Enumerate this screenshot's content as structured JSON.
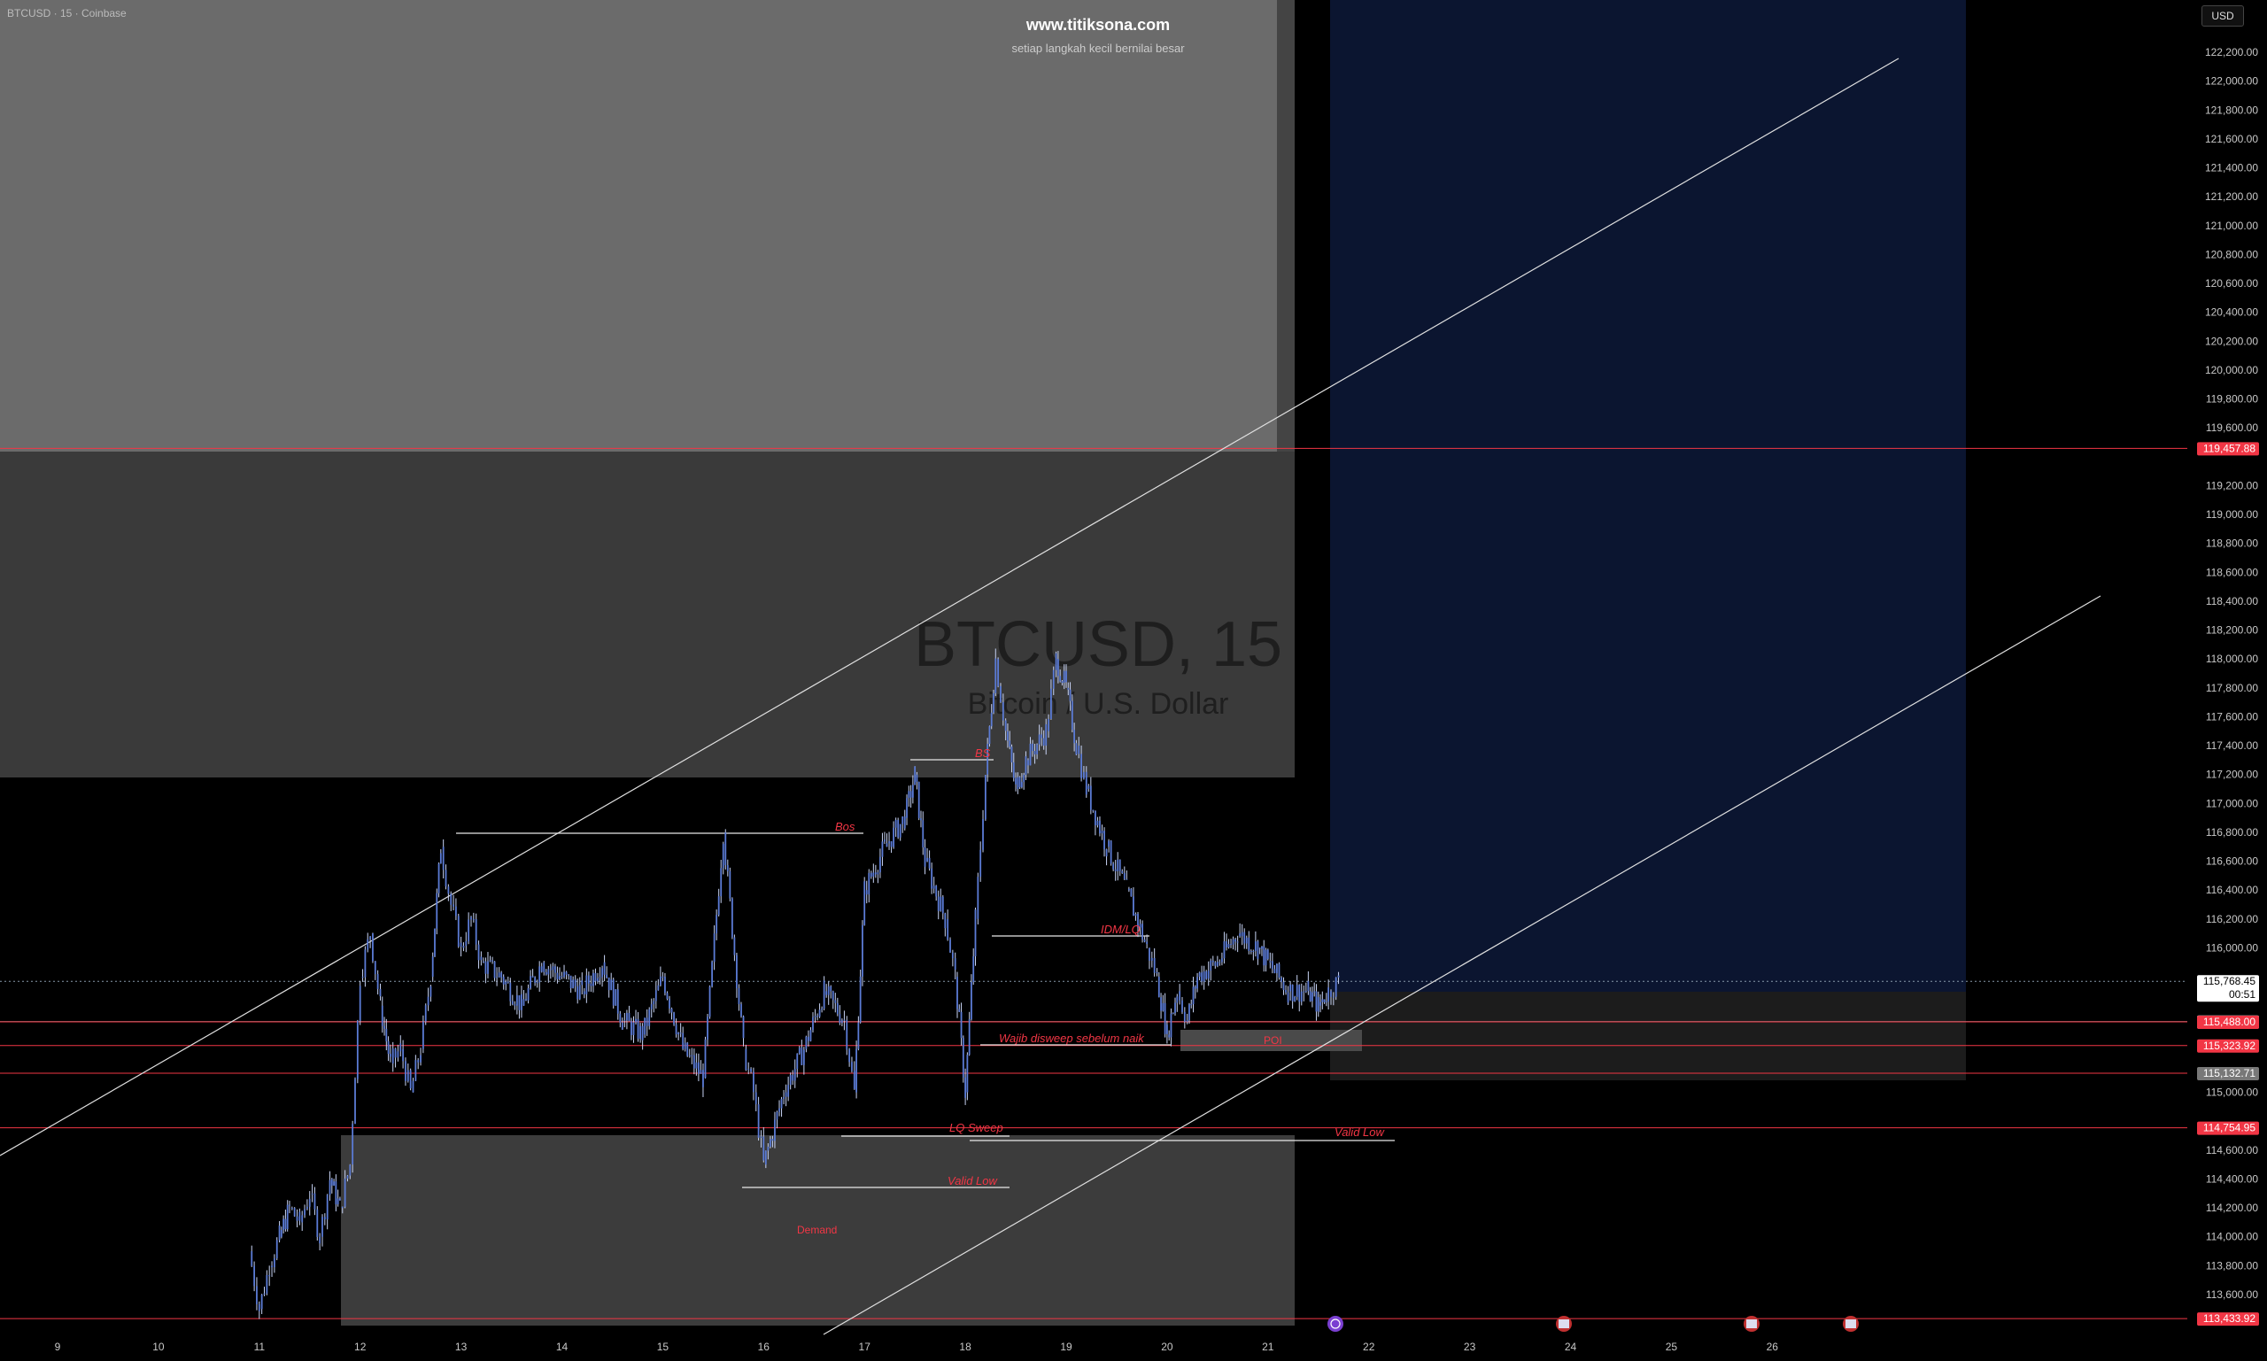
{
  "header": {
    "symbol": "BTCUSD · 15 · Coinbase",
    "brand": "www.titiksona.com",
    "tagline": "setiap langkah kecil bernilai besar",
    "currency_button": "USD"
  },
  "watermark": {
    "symbol": "BTCUSD, 15",
    "description": "Bitcoin / U.S. Dollar"
  },
  "colors": {
    "background": "#000000",
    "candle_up": "#5b7bd5",
    "candle_wick": "#c8d4f5",
    "supply_zone": "#6b6b6b",
    "supply_zone_dark": "#3a3a3a",
    "demand_zone": "#3c3c3c",
    "target_zone": "#0b1530",
    "annotation_red": "#f23645",
    "trendline": "#e0e0e0"
  },
  "annotations": {
    "bos": "Bos",
    "bs": "BS",
    "idm": "IDM/LQ",
    "wajib": "Wajib disweep sebelum naik",
    "poi": "POI",
    "lq_sweep": "LQ Sweep",
    "valid_low_1": "Valid Low",
    "valid_low_2": "Valid Low",
    "demand": "Demand"
  },
  "chart_data": {
    "type": "line",
    "title": "BTCUSD · 15 · Coinbase",
    "xlabel": "",
    "ylabel": "",
    "ylim": [
      113300,
      122300
    ],
    "x_ticks": [
      "9",
      "10",
      "11",
      "12",
      "13",
      "14",
      "15",
      "16",
      "17",
      "18",
      "19",
      "20",
      "21",
      "22",
      "23",
      "24",
      "25",
      "26"
    ],
    "y_ticks": [
      "122,200.00",
      "122,000.00",
      "121,800.00",
      "121,600.00",
      "121,400.00",
      "121,200.00",
      "121,000.00",
      "120,800.00",
      "120,600.00",
      "120,400.00",
      "120,200.00",
      "120,000.00",
      "119,800.00",
      "119,600.00",
      "119,200.00",
      "119,000.00",
      "118,800.00",
      "118,600.00",
      "118,400.00",
      "118,200.00",
      "118,000.00",
      "117,800.00",
      "117,600.00",
      "117,400.00",
      "117,200.00",
      "117,000.00",
      "116,800.00",
      "116,600.00",
      "116,400.00",
      "116,200.00",
      "116,000.00",
      "115,000.00",
      "114,600.00",
      "114,400.00",
      "114,200.00",
      "114,000.00",
      "113,800.00",
      "113,600.00"
    ],
    "series": [
      {
        "x": [
          10.9,
          11.0,
          11.1,
          11.2,
          11.3,
          11.4,
          11.5,
          11.6,
          11.7,
          11.8,
          11.9,
          12.0,
          12.1,
          12.2,
          12.3,
          12.4,
          12.5,
          12.6,
          12.7,
          12.8,
          12.9,
          13.0,
          13.1,
          13.2,
          13.4,
          13.6,
          13.8,
          14.0,
          14.2,
          14.4,
          14.6,
          14.8,
          15.0,
          15.2,
          15.4,
          15.6,
          15.8,
          15.9,
          16.0,
          16.2,
          16.4,
          16.6,
          16.8,
          16.9,
          17.0,
          17.2,
          17.4,
          17.5,
          17.6,
          17.8,
          17.9,
          18.0,
          18.1,
          18.2,
          18.3,
          18.4,
          18.5,
          18.6,
          18.8,
          18.9,
          19.0,
          19.1,
          19.2,
          19.4,
          19.6,
          19.8,
          19.9,
          20.0,
          20.1,
          20.2,
          20.3,
          20.5,
          20.7,
          20.9,
          21.0,
          21.2,
          21.4,
          21.5,
          21.6,
          21.7
        ],
        "values": [
          113900,
          113500,
          113800,
          114000,
          114200,
          114100,
          114300,
          114000,
          114400,
          114200,
          114500,
          115800,
          116100,
          115600,
          115200,
          115300,
          115000,
          115300,
          115800,
          116700,
          116300,
          116000,
          116200,
          115900,
          115800,
          115600,
          115900,
          115800,
          115700,
          115900,
          115500,
          115400,
          115800,
          115300,
          115100,
          116800,
          115300,
          115000,
          114500,
          115000,
          115300,
          115700,
          115500,
          115000,
          116400,
          116700,
          116900,
          117200,
          116600,
          116200,
          115800,
          115000,
          116200,
          117200,
          118000,
          117500,
          117100,
          117300,
          117500,
          118000,
          117800,
          117400,
          117100,
          116700,
          116400,
          116000,
          115800,
          115400,
          115700,
          115500,
          115800,
          115900,
          116100,
          116000,
          115900,
          115700,
          115700,
          115600,
          115700,
          115768
        ]
      }
    ],
    "horizontal_lines": [
      {
        "label": "119,457.88",
        "value": 119457.88
      },
      {
        "label": "115,768.45",
        "value": 115768.45
      },
      {
        "label": "115,489.83",
        "value": 115489.83
      },
      {
        "label": "115,488.00",
        "value": 115488
      },
      {
        "label": "115,323.92",
        "value": 115323.92
      },
      {
        "label": "115,132.71",
        "value": 115132.71
      },
      {
        "label": "114,754.95",
        "value": 114754.95
      },
      {
        "label": "113,433.92",
        "value": 113433.92
      }
    ],
    "countdown": "00:51"
  }
}
